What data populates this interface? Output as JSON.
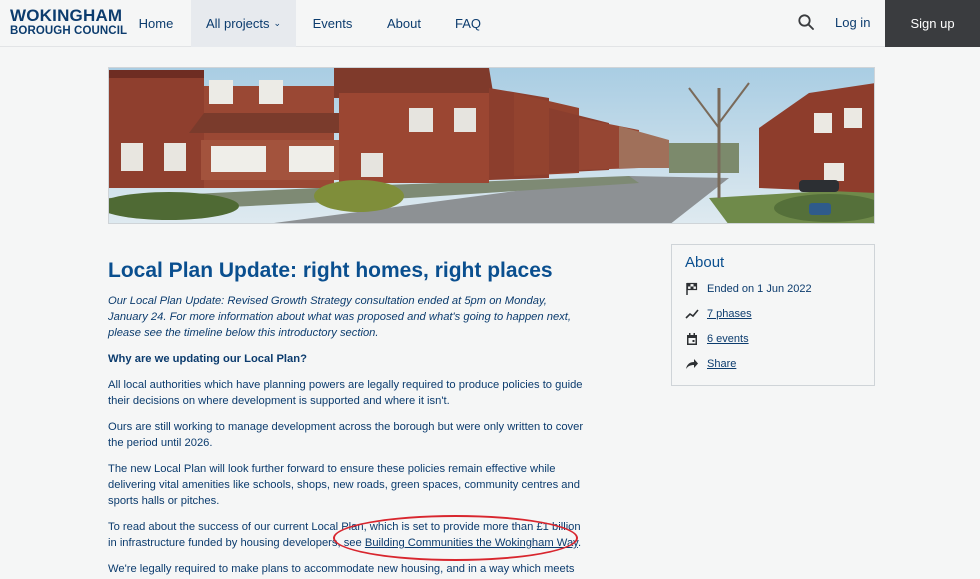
{
  "header": {
    "logo_line1": "WOKINGHAM",
    "logo_line2": "BOROUGH COUNCIL",
    "nav": [
      "Home",
      "All projects",
      "Events",
      "About",
      "FAQ"
    ],
    "login": "Log in",
    "signup": "Sign up"
  },
  "page": {
    "title": "Local Plan Update: right homes, right places",
    "intro": "Our Local Plan Update: Revised Growth Strategy consultation ended at 5pm on Monday, January 24. For more information about what was proposed and what's going to happen next, please see the timeline below this introductory section.",
    "question": "Why are we updating our Local Plan?",
    "p1": "All local authorities which have planning powers are legally required to produce policies to guide their decisions on where development is supported and where it isn't.",
    "p2": "Ours are still working to manage development across the borough but were only written to cover the period until 2026.",
    "p3": "The new Local Plan will look further forward to ensure these policies remain effective while delivering vital amenities like schools, shops, new roads, green spaces, community centres and sports halls or pitches.",
    "p4_pre": "To read about the success of our current Local Plan, which is set to provide more than £1 billion in infrastructure funded by housing developers, see ",
    "p4_link": "Building Communities the Wokingham Way",
    "p4_post": ".",
    "p5": "We're legally required to make plans to accommodate new housing, and in a way which meets"
  },
  "about": {
    "title": "About",
    "ended": "Ended on 1 Jun 2022",
    "phases": "7 phases",
    "events": "6 events",
    "share": "Share"
  },
  "colors": {
    "brand": "#0c3c6e",
    "heading": "#0a4f8f",
    "signup_bg": "#3a3c3f",
    "annotation": "#d8262e"
  }
}
